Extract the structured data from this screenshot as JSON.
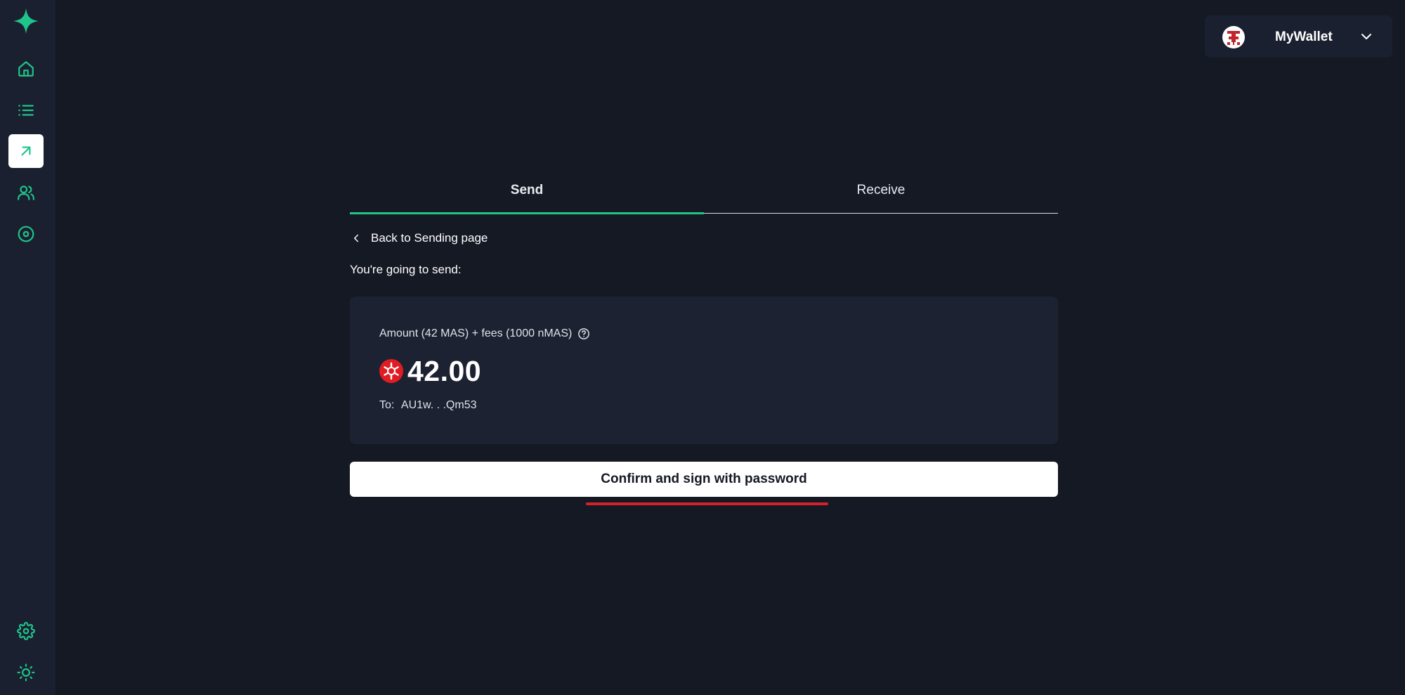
{
  "sidebar": {
    "logo_icon": "sparkle-logo-icon",
    "items": [
      {
        "name": "home",
        "icon": "home-icon"
      },
      {
        "name": "transactions",
        "icon": "list-icon"
      },
      {
        "name": "send-receive",
        "icon": "arrow-up-right-icon",
        "active": true
      },
      {
        "name": "contacts",
        "icon": "users-icon"
      },
      {
        "name": "assets",
        "icon": "target-icon"
      },
      {
        "name": "settings",
        "icon": "gear-icon"
      },
      {
        "name": "theme",
        "icon": "sun-icon"
      }
    ],
    "accent_color": "#1ec58a"
  },
  "wallet": {
    "name": "MyWallet",
    "avatar_icon": "pixel-avatar-icon"
  },
  "tabs": [
    {
      "label": "Send",
      "active": true
    },
    {
      "label": "Receive",
      "active": false
    }
  ],
  "back_link": "Back to Sending page",
  "intro_text": "You're going to send:",
  "summary": {
    "amount_label": "Amount (42 MAS) + fees (1000 nMAS)",
    "amount_value": "42.00",
    "to_label": "To:",
    "to_address": "AU1w. . .Qm53"
  },
  "confirm_button": "Confirm and sign with password",
  "colors": {
    "background": "#151924",
    "sidebar": "#1b2030",
    "card": "#1d2232",
    "accent": "#1ec58a",
    "highlight": "#d8202a"
  }
}
